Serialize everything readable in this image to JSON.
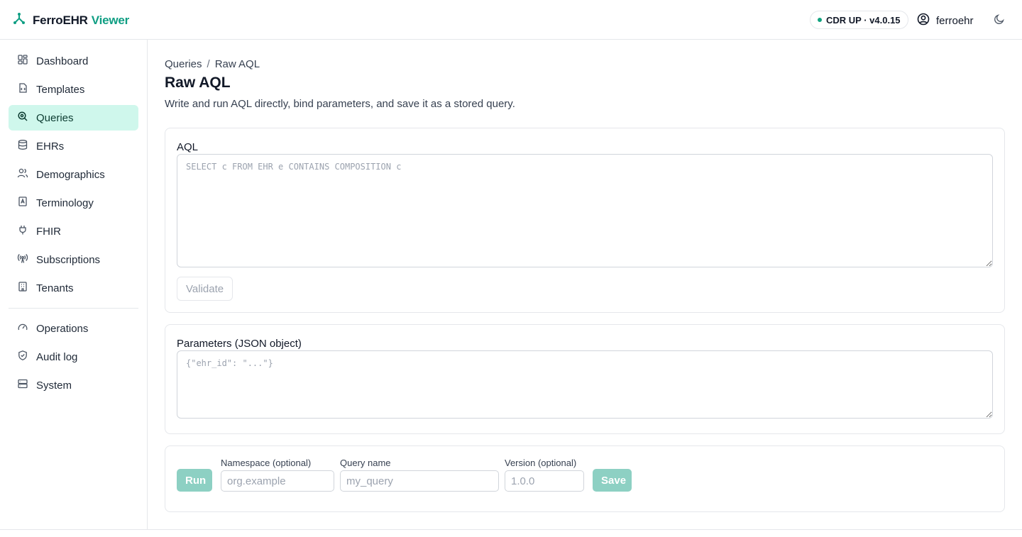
{
  "app": {
    "brand_name": "FerroEHR",
    "brand_accent": "Viewer",
    "status": "CDR UP · v4.0.15",
    "username": "ferroehr"
  },
  "colors": {
    "accent": "#0f9e83",
    "active_nav_bg": "#cff7ec",
    "primary_button": "#8dd0c3",
    "status_dot": "#10a37f"
  },
  "sidebar": {
    "items": [
      {
        "label": "Dashboard",
        "icon": "dashboard-icon"
      },
      {
        "label": "Templates",
        "icon": "file-code-icon"
      },
      {
        "label": "Queries",
        "icon": "search-icon",
        "active": true
      },
      {
        "label": "EHRs",
        "icon": "database-icon"
      },
      {
        "label": "Demographics",
        "icon": "users-icon"
      },
      {
        "label": "Terminology",
        "icon": "book-icon"
      },
      {
        "label": "FHIR",
        "icon": "plug-icon"
      },
      {
        "label": "Subscriptions",
        "icon": "broadcast-icon"
      },
      {
        "label": "Tenants",
        "icon": "building-icon"
      }
    ],
    "secondary_items": [
      {
        "label": "Operations",
        "icon": "gauge-icon"
      },
      {
        "label": "Audit log",
        "icon": "shield-icon"
      },
      {
        "label": "System",
        "icon": "server-icon"
      }
    ]
  },
  "breadcrumb": [
    "Queries",
    "Raw AQL"
  ],
  "breadcrumb_sep": "/",
  "page": {
    "title": "Raw AQL",
    "subtitle": "Write and run AQL directly, bind parameters, and save it as a stored query."
  },
  "aql_card": {
    "label": "AQL",
    "placeholder": "SELECT c FROM EHR e CONTAINS COMPOSITION c",
    "value": "",
    "validate_label": "Validate"
  },
  "params_card": {
    "label": "Parameters (JSON object)",
    "placeholder": "{\"ehr_id\": \"...\"}",
    "value": ""
  },
  "run_card": {
    "run_label": "Run",
    "namespace_label": "Namespace (optional)",
    "namespace_placeholder": "org.example",
    "query_name_label": "Query name",
    "query_name_placeholder": "my_query",
    "version_label": "Version (optional)",
    "version_placeholder": "1.0.0",
    "save_label": "Save"
  }
}
